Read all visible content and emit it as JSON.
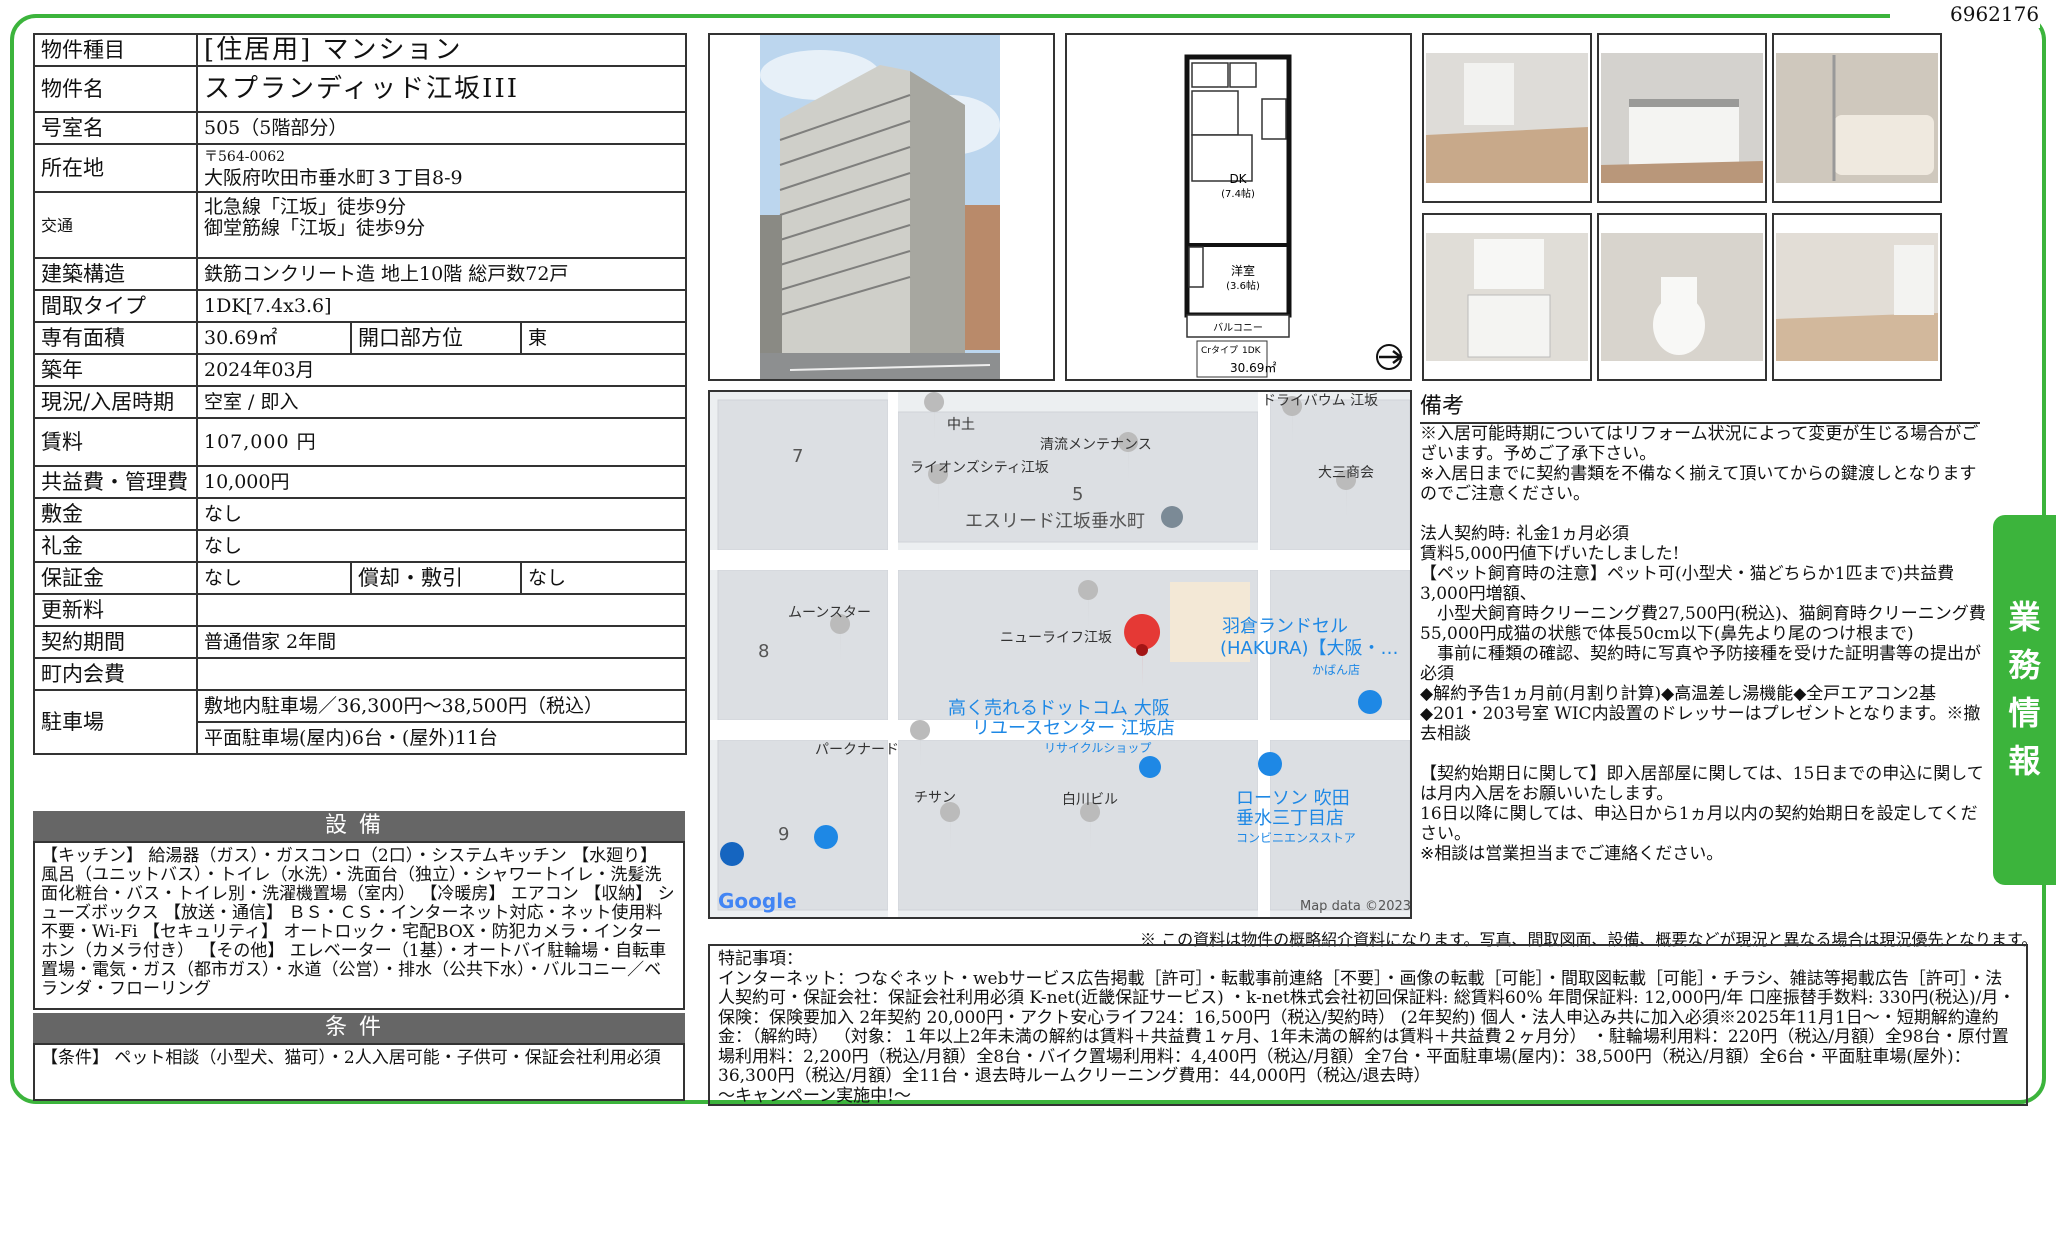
{
  "doc_number": "6962176",
  "side_tab": "業務情報",
  "property": {
    "type_label": "物件種目",
    "type_value": "[住居用] マンション",
    "name_label": "物件名",
    "name_value": "スプランディッド江坂III",
    "room_label": "号室名",
    "room_value": "505（5階部分）",
    "address_label": "所在地",
    "postal": "〒564-0062",
    "address": "大阪府吹田市垂水町３丁目8-9",
    "access_label": "交通",
    "access_1": "北急線「江坂」徒歩9分",
    "access_2": "御堂筋線「江坂」徒歩9分",
    "structure_label": "建築構造",
    "structure_value": "鉄筋コンクリート造 地上10階 総戸数72戸",
    "layout_label": "間取タイプ",
    "layout_value": "1DK[7.4x3.6]",
    "area_label": "専有面積",
    "area_value": "30.69㎡",
    "direction_label": "開口部方位",
    "direction_value": "東",
    "built_label": "築年",
    "built_value": "2024年03月",
    "status_label": "現況/入居時期",
    "status_value": "空室 / 即入",
    "rent_label": "賃料",
    "rent_value": "107,000 円",
    "fee_label": "共益費・管理費",
    "fee_value": "10,000円",
    "deposit_label": "敷金",
    "deposit_value": "なし",
    "key_label": "礼金",
    "key_value": "なし",
    "guarantee_label": "保証金",
    "guarantee_value": "なし",
    "amort_label": "償却・敷引",
    "amort_value": "なし",
    "renewal_label": "更新料",
    "renewal_value": "",
    "contract_label": "契約期間",
    "contract_value": "普通借家 2年間",
    "town_label": "町内会費",
    "town_value": "",
    "parking_label": "駐車場",
    "parking_1": "敷地内駐車場／36,300円～38,500円（税込）",
    "parking_2": "平面駐車場(屋内)6台・(屋外)11台"
  },
  "equipment": {
    "title": "設備",
    "text": "【キッチン】 給湯器（ガス）・ガスコンロ（2口）・システムキッチン 【水廻り】 風呂（ユニットバス）・トイレ（水洗）・洗面台（独立）・シャワートイレ・洗髪洗面化粧台・バス・トイレ別・洗濯機置場（室内） 【冷暖房】 エアコン 【収納】 シューズボックス 【放送・通信】 ＢＳ・ＣＳ・インターネット対応・ネット使用料不要・Wi-Fi 【セキュリティ】 オートロック・宅配BOX・防犯カメラ・インターホン（カメラ付き） 【その他】 エレベーター（1基）・オートバイ駐輪場・自転車置場・電気・ガス（都市ガス）・水道（公営）・排水（公共下水）・バルコニー／ベランダ・フローリング"
  },
  "conditions": {
    "title": "条件",
    "text": "【条件】 ペット相談（小型犬、猫可）・2人入居可能・子供可・保証会社利用必須"
  },
  "floorplan": {
    "dk": "DK",
    "dk_size": "(7.4帖)",
    "western": "洋室",
    "western_size": "(3.6帖)",
    "balcony": "バルコニー",
    "type": "Crタイプ",
    "layout": "1DK",
    "area": "30.69㎡"
  },
  "map": {
    "labels": [
      "中土",
      "清流メンテナンス",
      "ドライバウム 江坂",
      "ライオンズシティ江坂",
      "大三商会",
      "エスリード江坂垂水町",
      "ムーンスター",
      "ニューライフ江坂",
      "羽倉ランドセル",
      "(HAKURA)【大阪・…",
      "かばん店",
      "高く売れるドットコム 大阪",
      "リユースセンター 江坂店",
      "リサイクルショップ",
      "パークナード",
      "チサン",
      "白川ビル",
      "ローソン 吹田",
      "垂水三丁目店",
      "コンビニエンスストア"
    ],
    "block_numbers": [
      "7",
      "5",
      "8",
      "9"
    ],
    "google": "Google",
    "copyright": "Map data ©2023"
  },
  "remarks": {
    "title": "備考",
    "text": "※入居可能時期についてはリフォーム状況によって変更が生じる場合がございます。予めご了承下さい。\n※入居日までに契約書類を不備なく揃えて頂いてからの鍵渡しとなりますのでご注意ください。\n\n法人契約時: 礼金1ヵ月必須\n賃料5,000円値下げいたしました!\n【ペット飼育時の注意】ペット可(小型犬・猫どちらか1匹まで)共益費3,000円増額、\n　小型犬飼育時クリーニング費27,500円(税込)、猫飼育時クリーニング費55,000円成猫の状態で体長50cm以下(鼻先より尾のつけ根まで)\n　事前に種類の確認、契約時に写真や予防接種を受けた証明書等の提出が必須\n◆解約予告1ヵ月前(月割り計算)◆高温差し湯機能◆全戸エアコン2基\n◆201・203号室 WIC内設置のドレッサーはプレゼントとなります。※撤去相談\n\n【契約始期日に関して】即入居部屋に関しては、15日までの申込に関しては月内入居をお願いいたします。\n16日以降に関しては、申込日から1ヵ月以内の契約始期日を設定してください。\n※相談は営業担当までご連絡ください。"
  },
  "notice": "※ この資料は物件の概略紹介資料になります。写真、間取図面、設備、概要などが現況と異なる場合は現況優先となります。",
  "notes": {
    "text": "特記事項：\nインターネット：つなぐネット・webサービス広告掲載［許可］・転載事前連絡［不要］・画像の転載［可能］・間取図転載［可能］・チラシ、雑誌等掲載広告［許可］・法人契約可・保証会社：保証会社利用必須 K-net(近畿保証サービス) ・k-net株式会社初回保証料: 総賃料60% 年間保証料: 12,000円/年 口座振替手数料: 330円(税込)/月・保険：保険要加入 2年契約 20,000円・アクト安心ライフ24：16,500円（税込/契約時） (2年契約) 個人・法人申込み共に加入必須※2025年11月1日～・短期解約違約金：（解約時） （対象：１年以上2年未満の解約は賃料＋共益費１ヶ月、1年未満の解約は賃料＋共益費２ヶ月分） ・駐輪場利用料：220円（税込/月額）全98台・原付置場利用料：2,200円（税込/月額）全8台・バイク置場利用料：4,400円（税込/月額）全7台・平面駐車場(屋内)：38,500円（税込/月額）全6台・平面駐車場(屋外)：36,300円（税込/月額）全11台・退去時ルームクリーニング費用：44,000円（税込/退去時）\n～キャンペーン実施中!～"
  },
  "colors": {
    "frame": "#3cb43c",
    "section_header": "#666666",
    "map_bg": "#eceff1",
    "map_pin": "#e53935",
    "map_blue": "#1e88e5"
  }
}
